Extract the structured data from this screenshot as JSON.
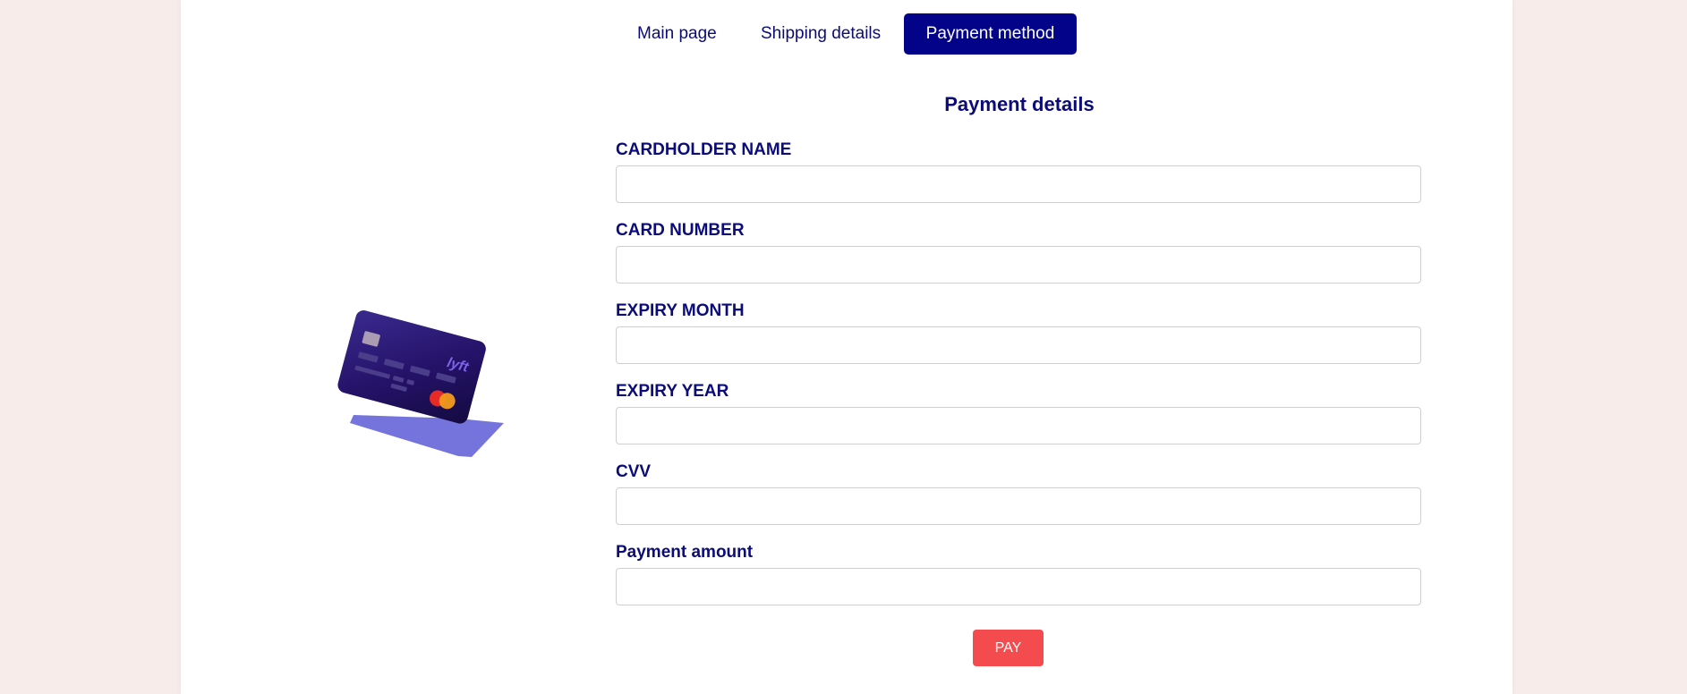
{
  "nav": {
    "items": [
      {
        "label": "Main page"
      },
      {
        "label": "Shipping details"
      },
      {
        "label": "Payment method"
      }
    ],
    "active_index": 2
  },
  "form": {
    "title": "Payment details",
    "fields": [
      {
        "label": "CARDHOLDER NAME",
        "value": ""
      },
      {
        "label": "CARD NUMBER",
        "value": ""
      },
      {
        "label": "EXPIRY MONTH",
        "value": ""
      },
      {
        "label": "EXPIRY YEAR",
        "value": ""
      },
      {
        "label": "CVV",
        "value": ""
      },
      {
        "label": "Payment amount",
        "value": ""
      }
    ],
    "submit_label": "PAY"
  },
  "illustration": {
    "card_brand_logo": "lyft",
    "network_icon": "mastercard-icon"
  },
  "colors": {
    "page_background": "#f8eceb",
    "content_background": "#ffffff",
    "primary": "#03038a",
    "text": "#0b0b7a",
    "pay_button": "#f44b4f",
    "card_shadow": "#7474dc"
  }
}
